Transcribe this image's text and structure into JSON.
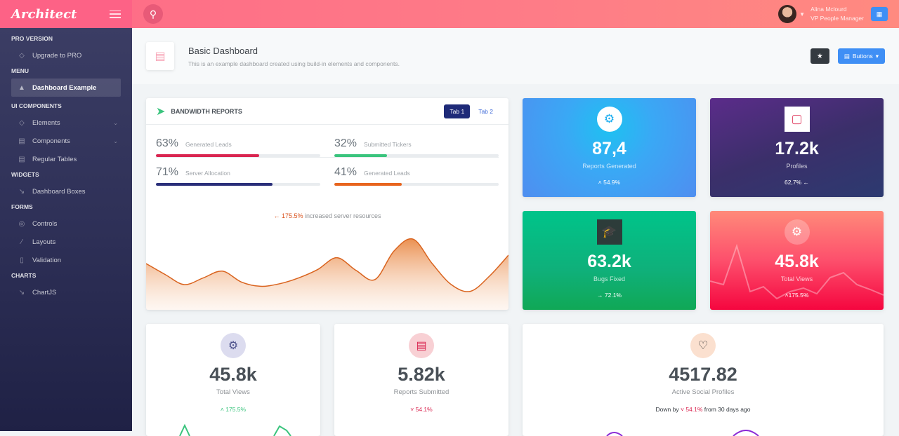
{
  "header": {
    "logo": "Architect",
    "user": {
      "name": "Alina Mclourd",
      "role": "VP People Manager"
    }
  },
  "sidebar": {
    "sections": [
      {
        "title": "PRO VERSION",
        "items": [
          {
            "label": "Upgrade to PRO",
            "icon": "diamond-icon"
          }
        ]
      },
      {
        "title": "MENU",
        "items": [
          {
            "label": "Dashboard Example",
            "icon": "rocket-icon",
            "active": true
          }
        ]
      },
      {
        "title": "UI COMPONENTS",
        "items": [
          {
            "label": "Elements",
            "icon": "diamond-icon"
          },
          {
            "label": "Components",
            "icon": "car-icon"
          },
          {
            "label": "Regular Tables",
            "icon": "display-icon"
          }
        ]
      },
      {
        "title": "WIDGETS",
        "items": [
          {
            "label": "Dashboard Boxes",
            "icon": "graph-icon"
          }
        ]
      },
      {
        "title": "FORMS",
        "items": [
          {
            "label": "Controls",
            "icon": "light-icon"
          },
          {
            "label": "Layouts",
            "icon": "eyedropper-icon"
          },
          {
            "label": "Validation",
            "icon": "pendrive-icon"
          }
        ]
      },
      {
        "title": "CHARTS",
        "items": [
          {
            "label": "ChartJS",
            "icon": "graph-icon"
          }
        ]
      }
    ]
  },
  "page": {
    "title": "Basic Dashboard",
    "subtitle": "This is an example dashboard created using build-in elements and components.",
    "buttons_label": "Buttons"
  },
  "bandwidth": {
    "title": "BANDWIDTH REPORTS",
    "tabs": [
      "Tab 1",
      "Tab 2"
    ],
    "progress": [
      {
        "pct": "63%",
        "label": "Generated Leads",
        "value": 63,
        "color": "#d92550"
      },
      {
        "pct": "32%",
        "label": "Submitted Tickers",
        "value": 32,
        "color": "#3ac47d"
      },
      {
        "pct": "71%",
        "label": "Server Allocation",
        "value": 71,
        "color": "#2a2f7a"
      },
      {
        "pct": "41%",
        "label": "Generated Leads",
        "value": 41,
        "color": "#e8651e"
      }
    ],
    "note_value": "175.5%",
    "note_text": "increased server resources",
    "chart_values": [
      55,
      42,
      30,
      38,
      46,
      33,
      28,
      31,
      38,
      48,
      62,
      47,
      36,
      70,
      84,
      55,
      30,
      22,
      40,
      65
    ]
  },
  "stats": [
    {
      "value": "87,4",
      "label": "Reports Generated",
      "change": "54.9%",
      "dir": "up"
    },
    {
      "value": "17.2k",
      "label": "Profiles",
      "change": "62,7%",
      "dir": "left"
    },
    {
      "value": "63.2k",
      "label": "Bugs Fixed",
      "change": "72.1%",
      "dir": "right"
    },
    {
      "value": "45.8k",
      "label": "Total Views",
      "change": "175.5%",
      "dir": "up"
    }
  ],
  "widgets": [
    {
      "value": "45.8k",
      "label": "Total Views",
      "change": "175.5%",
      "dir": "up"
    },
    {
      "value": "5.82k",
      "label": "Reports Submitted",
      "change": "54.1%",
      "dir": "down"
    },
    {
      "value": "4517.82",
      "label": "Active Social Profiles",
      "prefix": "Down by",
      "change": "54.1%",
      "suffix": "from 30 days ago"
    }
  ]
}
